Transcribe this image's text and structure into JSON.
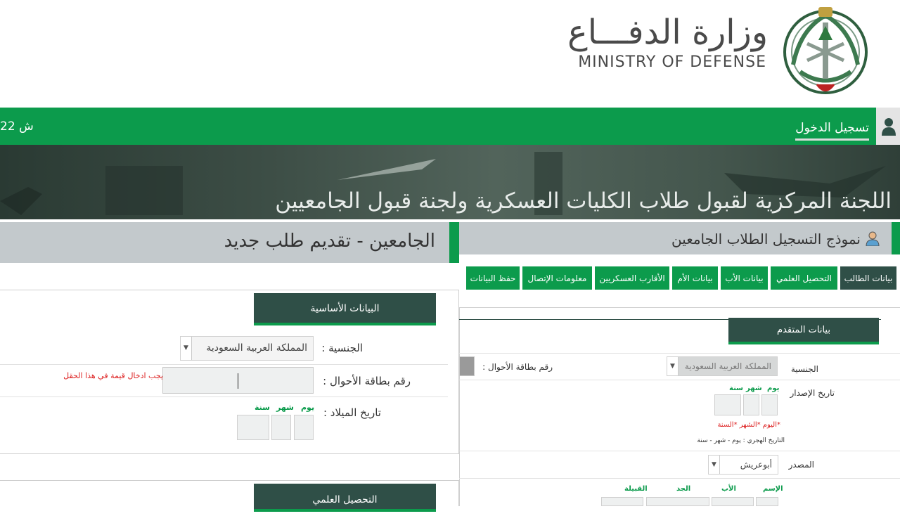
{
  "header": {
    "ministry_ar": "وزارة الدفـــاع",
    "ministry_en": "MINISTRY OF DEFENSE"
  },
  "nav": {
    "date": "22 ش",
    "login": "تسجيل الدخول"
  },
  "banner": {
    "title": "اللجنة المركزية لقبول طلاب الكليات العسكرية ولجنة قبول الجامعيين"
  },
  "left_panel": {
    "title": "الجامعين - تقديم طلب جديد",
    "section_basic": "البيانات الأساسية",
    "nationality_label": "الجنسية :",
    "nationality_value": "المملكة العربية السعودية",
    "civil_id_label": "رقم بطاقة الأحوال :",
    "civil_id_error": "يجب ادخال قيمة في هذا الحقل",
    "birth_date_label": "تاريخ الميلاد :",
    "day": "يوم",
    "month": "شهر",
    "year": "سنة",
    "section_academic": "التحصيل العلمي"
  },
  "right_panel": {
    "title": "نموذج التسجيل الطلاب الجامعين",
    "tabs": [
      "بيانات الطالب",
      "التحصيل العلمي",
      "بيانات الأب",
      "بيانات الأم",
      "الأقارب العسكريين",
      "معلومات الإتصال",
      "حفظ البيانات"
    ],
    "section_applicant": "بيانات المتقدم",
    "nationality_label": "الجنسية",
    "nationality_value": "المملكة العربية السعودية",
    "civil_id_label": "رقم بطاقة الأحوال :",
    "issue_date_label": "تاريخ الإصدار",
    "day": "يوم",
    "month": "شهر",
    "year": "سنة",
    "date_required": "*اليوم *الشهر *السنة",
    "hijri_note": "التاريخ الهجري : يوم - شهر - سنة",
    "source_label": "المصدر",
    "source_value": "أبوعريش",
    "name_first": "الإسم",
    "name_father": "الأب",
    "name_grandfather": "الجد",
    "name_tribe": "القبيلة"
  },
  "colors": {
    "green": "#0c9b4c",
    "dark_teal": "#2f4f47",
    "gray_bar": "#c3c9cc",
    "error_red": "#dd2222"
  }
}
